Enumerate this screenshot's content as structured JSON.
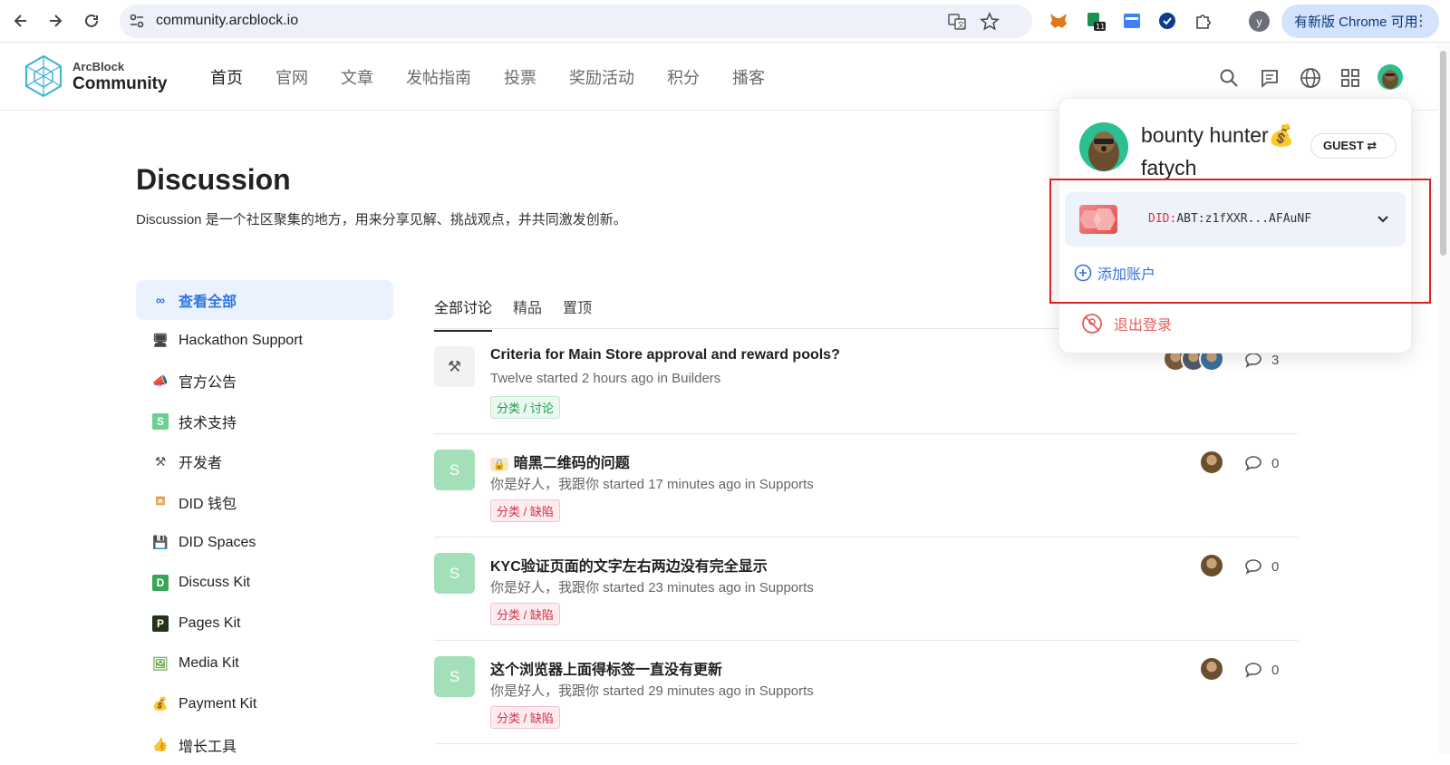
{
  "browser": {
    "url": "community.arcblock.io",
    "profile_initial": "y",
    "update_label": "有新版 Chrome 可用",
    "ext_badge": "11"
  },
  "header": {
    "logo_line1": "ArcBlock",
    "logo_line2": "Community",
    "nav": [
      "首页",
      "官网",
      "文章",
      "发帖指南",
      "投票",
      "奖励活动",
      "积分",
      "播客"
    ]
  },
  "page": {
    "title": "Discussion",
    "description": "Discussion 是一个社区聚集的地方，用来分享见解、挑战观点，并共同激发创新。"
  },
  "sidebar": {
    "items": [
      {
        "label": "查看全部",
        "icon": "infinity-icon",
        "glyph": "∞",
        "color": "#2f74e0"
      },
      {
        "label": "Hackathon Support",
        "icon": "monitor-icon",
        "glyph": "🖥",
        "color": "#444"
      },
      {
        "label": "官方公告",
        "icon": "megaphone-icon",
        "glyph": "📣",
        "color": "#c79a2a"
      },
      {
        "label": "技术支持",
        "icon": "s-letter-icon",
        "glyph": "S",
        "color": "#6ad18f"
      },
      {
        "label": "开发者",
        "icon": "tools-icon",
        "glyph": "⚒",
        "color": "#555"
      },
      {
        "label": "DID 钱包",
        "icon": "wallet-icon",
        "glyph": "⛾",
        "color": "#e5a24d"
      },
      {
        "label": "DID Spaces",
        "icon": "floppy-icon",
        "glyph": "💾",
        "color": "#555"
      },
      {
        "label": "Discuss Kit",
        "icon": "d-letter-icon",
        "glyph": "D",
        "color": "#3aa55a"
      },
      {
        "label": "Pages Kit",
        "icon": "p-letter-icon",
        "glyph": "P",
        "color": "#24331a"
      },
      {
        "label": "Media Kit",
        "icon": "image-icon",
        "glyph": "🖼",
        "color": "#6aa84f"
      },
      {
        "label": "Payment Kit",
        "icon": "money-bag-icon",
        "glyph": "💰",
        "color": "#b8873a"
      },
      {
        "label": "增长工具",
        "icon": "thumbs-up-icon",
        "glyph": "👍",
        "color": "#e5a24d"
      }
    ]
  },
  "tabs": [
    "全部讨论",
    "精品",
    "置顶"
  ],
  "posts": [
    {
      "title": "Criteria for Main Store approval and reward pools?",
      "meta": "Twelve started 2 hours ago in Builders",
      "tag": "分类 / 讨论",
      "tag_style": "green",
      "thumb": "⚒",
      "thumb_color": "#f2f2f2",
      "comments": "3",
      "prefix_icon": ""
    },
    {
      "title": "暗黑二维码的问题",
      "meta": "你是好人，我跟你 started 17 minutes ago in Supports",
      "tag": "分类 / 缺陷",
      "tag_style": "red",
      "thumb": "S",
      "thumb_color": "#a3e0b9",
      "comments": "0",
      "prefix_icon": "🔒"
    },
    {
      "title": "KYC验证页面的文字左右两边没有完全显示",
      "meta": "你是好人，我跟你 started 23 minutes ago in Supports",
      "tag": "分类 / 缺陷",
      "tag_style": "red",
      "thumb": "S",
      "thumb_color": "#a3e0b9",
      "comments": "0",
      "prefix_icon": ""
    },
    {
      "title": "这个浏览器上面得标签一直没有更新",
      "meta": "你是好人，我跟你 started 29 minutes ago in Supports",
      "tag": "分类 / 缺陷",
      "tag_style": "red",
      "thumb": "S",
      "thumb_color": "#a3e0b9",
      "comments": "0",
      "prefix_icon": ""
    }
  ],
  "popover": {
    "name_line1": "bounty hunter💰",
    "name_line2": "fatych",
    "role_badge": "GUEST ⇄",
    "did_prefix": "DID:",
    "did_value": "ABT:z1fXXR...AFAuNF",
    "add_account": "添加账户",
    "logout": "退出登录"
  }
}
